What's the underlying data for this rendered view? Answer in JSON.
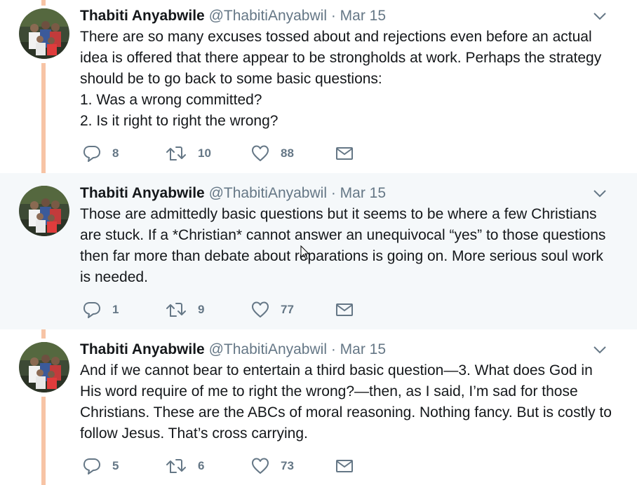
{
  "colors": {
    "thread_line": "#f7c4a5",
    "highlight_bg": "#f5f8fa",
    "secondary_text": "#657786",
    "primary_text": "#14171a"
  },
  "icons": {
    "reply": "reply-icon",
    "retweet": "retweet-icon",
    "like": "like-icon",
    "dm": "mail-icon",
    "caret": "chevron-down-icon"
  },
  "tweets": [
    {
      "name": "Thabiti Anyabwile",
      "handle": "@ThabitiAnyabwil",
      "separator": "·",
      "date": "Mar 15",
      "lines": [
        "There are so many excuses tossed about and rejections even before an actual idea is offered that there appear to be strongholds at work. Perhaps the strategy should be to go back to some basic questions:",
        "1. Was a wrong committed?",
        "2. Is it right to right the wrong?"
      ],
      "replies": "8",
      "retweets": "10",
      "likes": "88"
    },
    {
      "name": "Thabiti Anyabwile",
      "handle": "@ThabitiAnyabwil",
      "separator": "·",
      "date": "Mar 15",
      "lines": [
        "Those are admittedly basic questions but it seems to be where a few Christians are stuck. If a *Christian* cannot answer an unequivocal “yes” to those questions then far more than debate about reparations is going on. More serious soul work is needed."
      ],
      "replies": "1",
      "retweets": "9",
      "likes": "77"
    },
    {
      "name": "Thabiti Anyabwile",
      "handle": "@ThabitiAnyabwil",
      "separator": "·",
      "date": "Mar 15",
      "lines": [
        "And if we cannot bear to entertain a third basic question—3. What does God in His word require of me to right the wrong?—then, as I said, I’m sad for those Christians. These are the ABCs of moral reasoning. Nothing fancy. But is costly to follow Jesus. That’s cross carrying."
      ],
      "replies": "5",
      "retweets": "6",
      "likes": "73"
    }
  ]
}
